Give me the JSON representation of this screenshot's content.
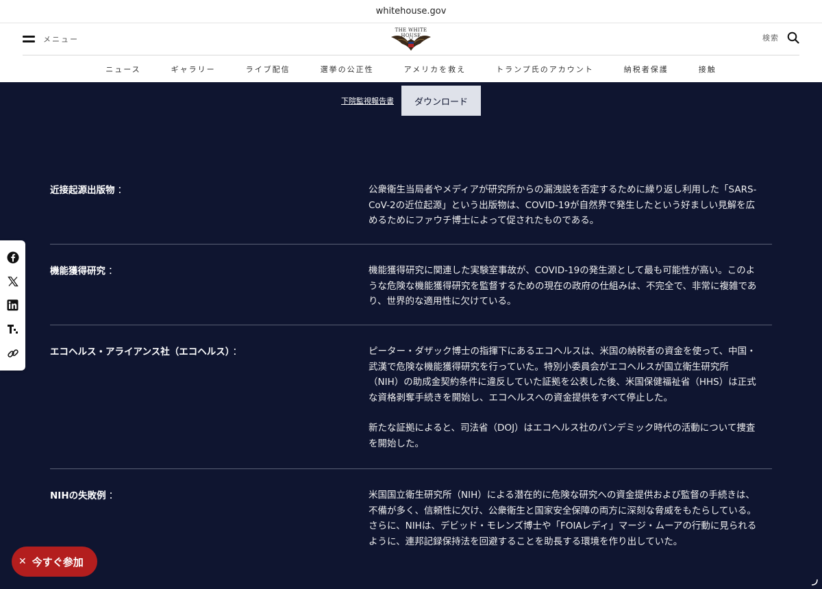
{
  "browser": {
    "url": "whitehouse.gov"
  },
  "header": {
    "menu_label": "メニュー",
    "logo_text": "THE WHITE HOUSE",
    "search_label": "検索",
    "nav": [
      "ニュース",
      "ギャラリー",
      "ライブ配信",
      "選挙の公正性",
      "アメリカを救え",
      "トランプ氏のアカウント",
      "納税者保護",
      "接触"
    ]
  },
  "report": {
    "link_label": "下院監視報告書",
    "download_label": "ダウンロード"
  },
  "rows": [
    {
      "label": "近接起源出版物",
      "colon": "：",
      "text": [
        "公衆衛生当局者やメディアが研究所からの漏洩説を否定するために繰り返し利用した「SARS-CoV-2の近位起源」という出版物は、COVID-19が自然界で発生したという好ましい見解を広めるためにファウチ博士によって促されたものである。"
      ]
    },
    {
      "label": "機能獲得研究",
      "colon": "：",
      "text": [
        "機能獲得研究に関連した実験室事故が、COVID-19の発生源として最も可能性が高い。このような危険な機能獲得研究を監督するための現在の政府の仕組みは、不完全で、非常に複雑であり、世界的な適用性に欠けている。"
      ]
    },
    {
      "label": "エコヘルス・アライアンス社（エコヘルス）",
      "colon": "：",
      "text": [
        "ピーター・ダザック博士の指揮下にあるエコヘルスは、米国の納税者の資金を使って、中国・武漢で危険な機能獲得研究を行っていた。特別小委員会がエコヘルスが国立衛生研究所（NIH）の助成金契約条件に違反していた証拠を公表した後、米国保健福祉省（HHS）は正式な資格剥奪手続きを開始し、エコヘルスへの資金提供をすべて停止した。",
        "新たな証拠によると、司法省（DOJ）はエコヘルス社のパンデミック時代の活動について捜査を開始した。"
      ]
    },
    {
      "label": "NIHの失敗例",
      "colon": "：",
      "text": [
        "米国国立衛生研究所（NIH）による潜在的に危険な研究への資金提供および監督の手続きは、不備が多く、信頼性に欠け、公衆衛生と国家安全保障の両方に深刻な脅威をもたらしている。さらに、NIHは、デビッド・モレンズ博士や「FOIAレディ」マージ・ムーアの行動に見られるように、連邦記録保持法を回避することを助長する環境を作り出していた。"
      ]
    }
  ],
  "share": [
    "facebook-icon",
    "x-icon",
    "linkedin-icon",
    "truth-social-icon",
    "link-icon"
  ],
  "join": {
    "label": "今すぐ参加"
  }
}
